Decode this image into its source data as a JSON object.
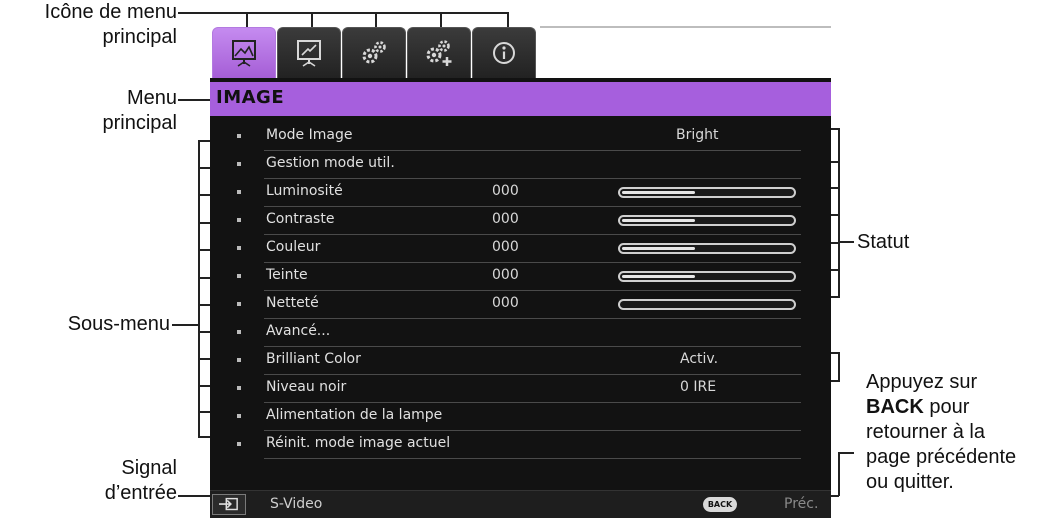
{
  "annotations": {
    "menu_icon": [
      "Icône de menu",
      "principal"
    ],
    "main_menu": [
      "Menu",
      "principal"
    ],
    "sub_menu": "Sous-menu",
    "input_signal": [
      "Signal",
      "d’entrée"
    ],
    "status": "Statut",
    "back_note": {
      "line1": "Appuyez sur",
      "line2_bold": "BACK",
      "line2_rest": " pour",
      "line3": "retourner à la",
      "line4": "page précédente",
      "line5": "ou quitter."
    }
  },
  "osd": {
    "tabs": [
      {
        "icon": "picture-icon",
        "active": true
      },
      {
        "icon": "display-icon",
        "active": false
      },
      {
        "icon": "settings-gears-icon",
        "active": false
      },
      {
        "icon": "advanced-settings-icon",
        "active": false
      },
      {
        "icon": "info-icon",
        "active": false
      }
    ],
    "menu_title": "IMAGE",
    "items": [
      {
        "label": "Mode Image",
        "value": "Bright"
      },
      {
        "label": "Gestion mode util."
      },
      {
        "label": "Luminosité",
        "number": "000",
        "level": 0.42
      },
      {
        "label": "Contraste",
        "number": "000",
        "level": 0.42
      },
      {
        "label": "Couleur",
        "number": "000",
        "level": 0.42
      },
      {
        "label": "Teinte",
        "number": "000",
        "level": 0.42
      },
      {
        "label": "Netteté",
        "number": "000",
        "level": 0.0
      },
      {
        "label": "Avancé..."
      },
      {
        "label": "Brilliant Color",
        "value": "Activ."
      },
      {
        "label": "Niveau noir",
        "value": "0 IRE"
      },
      {
        "label": "Alimentation de la lampe"
      },
      {
        "label": "Réinit. mode image actuel"
      }
    ],
    "bottom": {
      "source_icon": "input-source-icon",
      "source": "S-Video",
      "back_button": "BACK",
      "prev": "Préc."
    }
  },
  "colors": {
    "accent": "#a65fdd",
    "panel_bg": "#121212",
    "text": "#e0e0e0"
  }
}
